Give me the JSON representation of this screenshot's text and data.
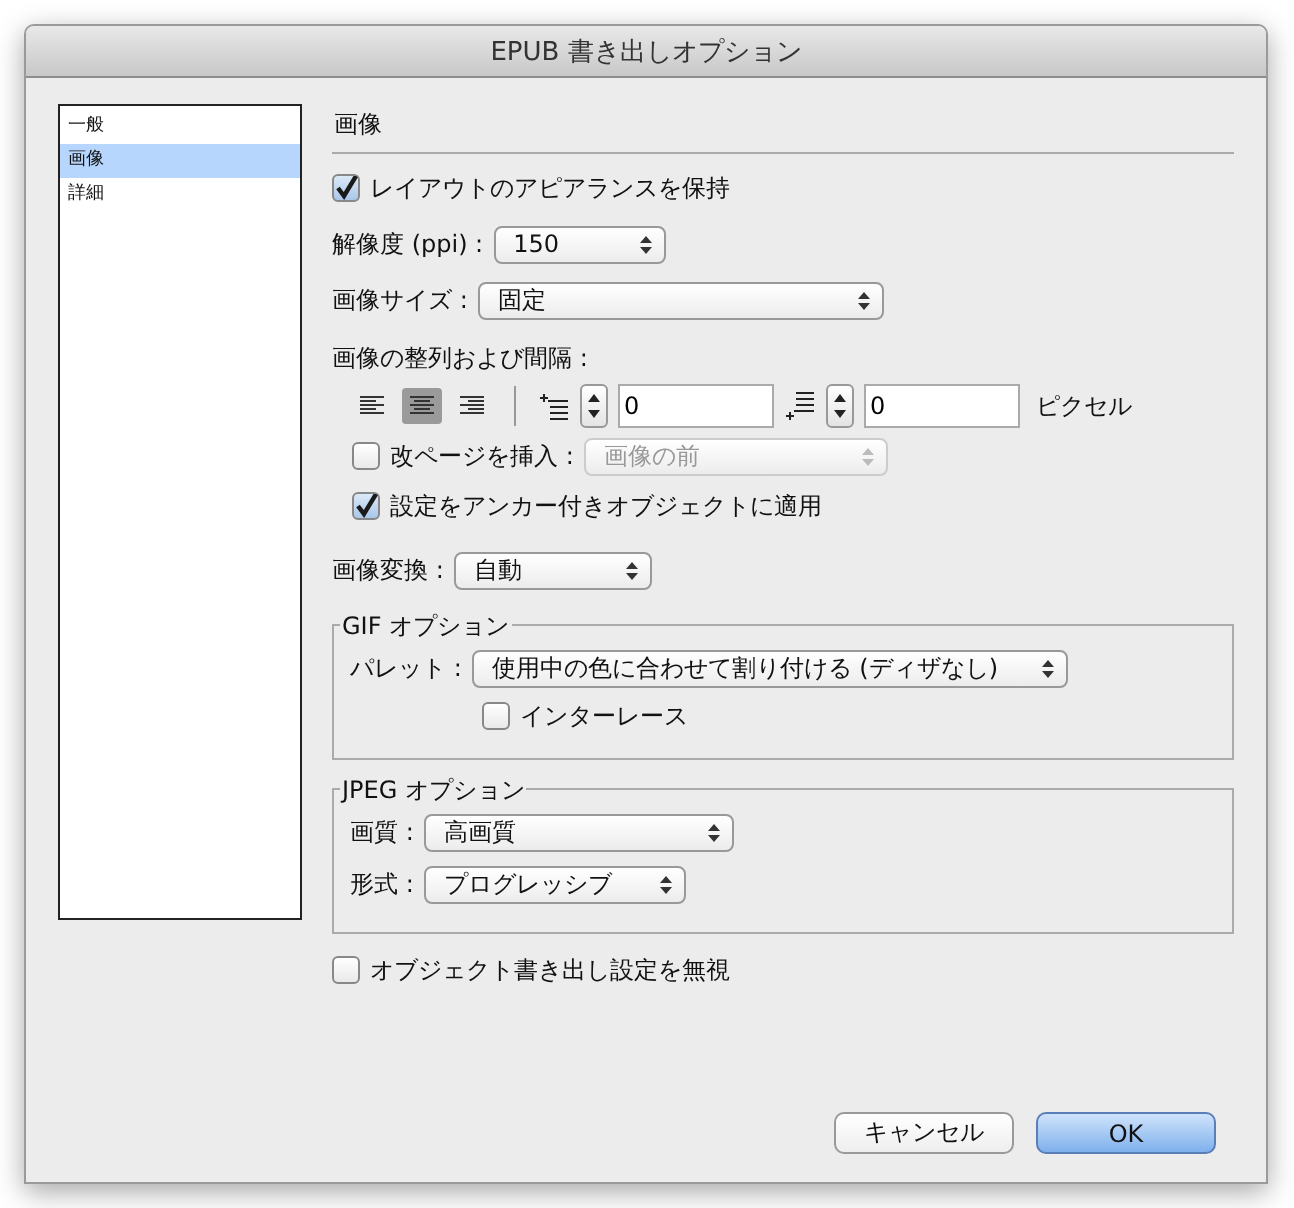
{
  "window": {
    "title": "EPUB 書き出しオプション"
  },
  "sidebar": {
    "items": [
      {
        "label": "一般",
        "selected": false
      },
      {
        "label": "画像",
        "selected": true
      },
      {
        "label": "詳細",
        "selected": false
      }
    ]
  },
  "section_title": "画像",
  "preserve_appearance": {
    "label": "レイアウトのアピアランスを保持",
    "checked": true
  },
  "resolution": {
    "label": "解像度 (ppi) :",
    "value": "150"
  },
  "image_size": {
    "label": "画像サイズ :",
    "value": "固定"
  },
  "alignment": {
    "label": "画像の整列および間隔 :",
    "align_buttons": [
      {
        "kind": "left",
        "selected": false
      },
      {
        "kind": "center",
        "selected": true
      },
      {
        "kind": "right",
        "selected": false
      }
    ],
    "space_before": "0",
    "space_after": "0",
    "unit": "ピクセル"
  },
  "page_break": {
    "label": "改ページを挿入 :",
    "checked": false,
    "value": "画像の前",
    "disabled": true
  },
  "apply_anchored": {
    "label": "設定をアンカー付きオブジェクトに適用",
    "checked": true
  },
  "conversion": {
    "label": "画像変換 :",
    "value": "自動"
  },
  "gif_options": {
    "title": "GIF オプション",
    "palette": {
      "label": "パレット :",
      "value": "使用中の色に合わせて割り付ける (ディザなし)"
    },
    "interlace": {
      "label": "インターレース",
      "checked": false
    }
  },
  "jpeg_options": {
    "title": "JPEG オプション",
    "quality": {
      "label": "画質 :",
      "value": "高画質"
    },
    "format": {
      "label": "形式 :",
      "value": "プログレッシブ"
    }
  },
  "ignore_object_settings": {
    "label": "オブジェクト書き出し設定を無視",
    "checked": false
  },
  "buttons": [
    {
      "label": "キャンセル",
      "kind": "normal"
    },
    {
      "label": "OK",
      "kind": "default"
    }
  ]
}
